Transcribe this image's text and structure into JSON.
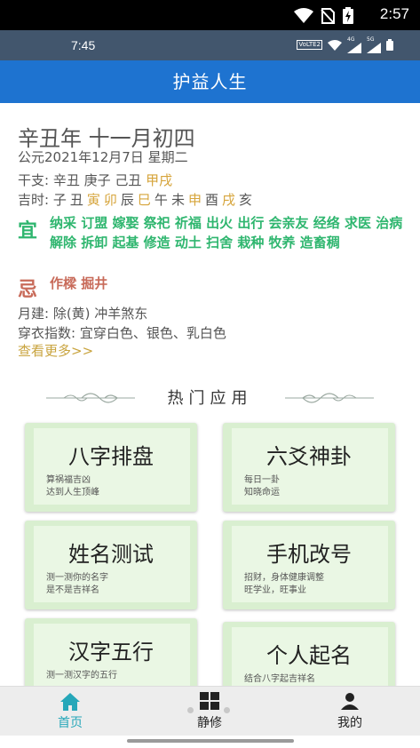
{
  "system_status": {
    "time": "2:57"
  },
  "app_status": {
    "time": "7:45",
    "network": "4G",
    "network2": "5G",
    "volte": "VoLTE2"
  },
  "appbar": {
    "title": "护益人生"
  },
  "almanac": {
    "lunar_date": "辛丑年 十一月初四",
    "solar_date": "公元2021年12月7日 星期二",
    "ganzhi": {
      "prefix": "干支: 辛丑 庚子 己丑 ",
      "highlight": "甲戌"
    },
    "hours": [
      {
        "label": "吉时: ",
        "good": false
      },
      {
        "label": "子",
        "good": false
      },
      {
        "label": "丑",
        "good": false
      },
      {
        "label": "寅",
        "good": true
      },
      {
        "label": "卯",
        "good": true
      },
      {
        "label": "辰",
        "good": false
      },
      {
        "label": "巳",
        "good": true
      },
      {
        "label": "午",
        "good": false
      },
      {
        "label": "未",
        "good": false
      },
      {
        "label": "申",
        "good": true
      },
      {
        "label": "酉",
        "good": false
      },
      {
        "label": "戌",
        "good": true
      },
      {
        "label": "亥",
        "good": false
      }
    ],
    "yi_label": "宜",
    "yi_items": "纳采 订盟 嫁娶 祭祀 祈福 出火 出行 会亲友 经络 求医 治病 解除 拆卸 起基 修造 动土 扫舍 栽种 牧养 造畜稠",
    "ji_label": "忌",
    "ji_items": "作樑 掘井",
    "month_build": "月建: 除(黄)  冲羊煞东",
    "dress_index": "穿衣指数: 宜穿白色、银色、乳白色",
    "more_link": "查看更多>>"
  },
  "hot_apps": {
    "title": "热门应用",
    "cards": [
      {
        "title": "八字排盘",
        "desc1": "算祸福吉凶",
        "desc2": "达到人生顶峰"
      },
      {
        "title": "六爻神卦",
        "desc1": "每日一卦",
        "desc2": "知晓命运"
      },
      {
        "title": "姓名测试",
        "desc1": "测一测你的名字",
        "desc2": "是不是吉祥名"
      },
      {
        "title": "手机改号",
        "desc1": "招财，身体健康调整",
        "desc2": "旺学业，旺事业"
      },
      {
        "title": "汉字五行",
        "desc1": "测一测汉字的五行",
        "desc2": ""
      },
      {
        "title": "个人起名",
        "desc1": "结合八字起吉祥名",
        "desc2": ""
      }
    ]
  },
  "bottom_nav": {
    "items": [
      {
        "label": "首页",
        "active": true
      },
      {
        "label": "静修",
        "active": false
      },
      {
        "label": "我的",
        "active": false
      }
    ],
    "colors": {
      "active": "#26a7b9",
      "inactive": "#222222"
    }
  },
  "colors": {
    "appbar": "#1e73d0",
    "yi": "#2fb66f",
    "ji": "#c86b5a",
    "highlight": "#d6a43a",
    "card": "#d9efd0"
  }
}
